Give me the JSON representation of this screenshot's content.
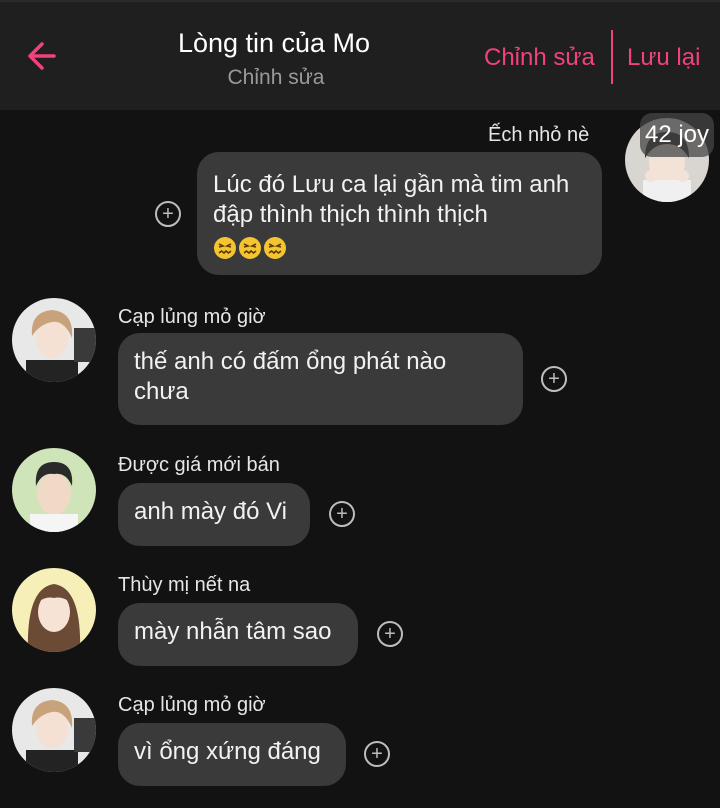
{
  "header": {
    "title": "Lòng tin của Mo",
    "subtitle": "Chỉnh sửa",
    "edit_label": "Chỉnh sửa",
    "save_label": "Lưu lại",
    "back_icon": "arrow-left-icon",
    "accent_color": "#f2427b"
  },
  "messages": [
    {
      "sender": "Ếch nhỏ nè",
      "text": "Lúc đó Lưu ca lại gần mà tim anh đập thình thịch thình thịch",
      "emoji": [
        "confounded-face",
        "confounded-face",
        "confounded-face"
      ],
      "side": "right",
      "badge": "42 joy"
    },
    {
      "sender": "Cạp lủng mỏ giờ",
      "text": "thế anh có đấm ổng phát nào chưa",
      "side": "left"
    },
    {
      "sender": "Được giá mới bán",
      "text": "anh mày đó Vi",
      "side": "left"
    },
    {
      "sender": "Thùy mị nết na",
      "text": "mày nhẫn tâm sao",
      "side": "left"
    },
    {
      "sender": "Cạp lủng mỏ giờ",
      "text": "vì ổng xứng đáng",
      "side": "left"
    }
  ]
}
